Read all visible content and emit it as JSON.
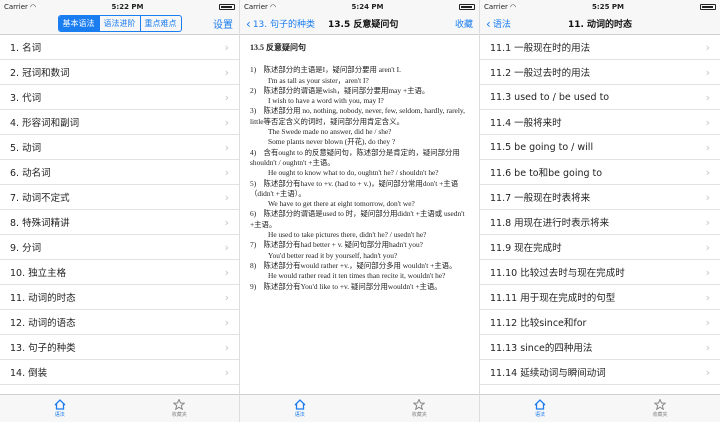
{
  "screen1": {
    "status": {
      "carrier": "Carrier",
      "time": "5:22 PM"
    },
    "segments": [
      "基本语法",
      "语法进阶",
      "重点难点"
    ],
    "settings_label": "设置",
    "items": [
      "1. 名词",
      "2. 冠词和数词",
      "3. 代词",
      "4. 形容词和副词",
      "5. 动词",
      "6. 动名词",
      "7. 动词不定式",
      "8. 特殊词精讲",
      "9. 分词",
      "10. 独立主格",
      "11. 动词的时态",
      "12. 动词的语态",
      "13. 句子的种类",
      "14. 倒装"
    ],
    "tabs": [
      "语法",
      "收藏夹"
    ]
  },
  "screen2": {
    "status": {
      "carrier": "Carrier",
      "time": "5:24 PM"
    },
    "back_label": "13. 句子的种类",
    "title": "13.5 反意疑问句",
    "favorite_label": "收藏",
    "heading": "13.5 反意疑问句",
    "lines": [
      {
        "t": "1)　陈述部分的主语是I，疑问部分要用 aren't I.",
        "ex": false
      },
      {
        "t": "I'm as tall as your sister，aren't I?",
        "ex": true
      },
      {
        "t": "2)　陈述部分的谓语是wish，疑问部分要用may +主语。",
        "ex": false
      },
      {
        "t": "I wish to have a word with you, may I?",
        "ex": true
      },
      {
        "t": "3)　陈述部分用 no, nothing, nobody, never, few, seldom, hardly, rarely, little等否定含义的词时，疑问部分用肯定含义。",
        "ex": false
      },
      {
        "t": "The Swede made no answer, did he / she?",
        "ex": true
      },
      {
        "t": "Some plants never blown (开花), do they ?",
        "ex": true
      },
      {
        "t": "4)　含有ought to 的反意疑问句，陈述部分是肯定的，疑问部分用shouldn't / oughtn't +主语。",
        "ex": false
      },
      {
        "t": "He ought to know what to do, oughtn't he? / shouldn't he?",
        "ex": true
      },
      {
        "t": "5)　陈述部分有have to +v. (had to + v.)，疑问部分常用don't +主语（didn't +主语）。",
        "ex": false
      },
      {
        "t": "We have to get there at eight tomorrow, don't we?",
        "ex": true
      },
      {
        "t": "6)　陈述部分的谓语是used to 时，疑问部分用didn't +主语或 usedn't +主语。",
        "ex": false
      },
      {
        "t": "He used to take pictures there, didn't he? / usedn't he?",
        "ex": true
      },
      {
        "t": "7)　陈述部分有had better + v. 疑问句部分用hadn't you?",
        "ex": false
      },
      {
        "t": "You'd better read it by yourself, hadn't you?",
        "ex": true
      },
      {
        "t": "8)　陈述部分有would rather +v.，疑问部分多用 wouldn't +主语。",
        "ex": false
      },
      {
        "t": "He would rather read it ten times than recite it, wouldn't he?",
        "ex": true
      },
      {
        "t": "9)　陈述部分有You'd like to +v. 疑问部分用wouldn't +主语。",
        "ex": false
      }
    ],
    "tabs": [
      "语法",
      "收藏夹"
    ]
  },
  "screen3": {
    "status": {
      "carrier": "Carrier",
      "time": "5:25 PM"
    },
    "back_label": "语法",
    "title": "11. 动词的时态",
    "items": [
      "11.1 一般现在时的用法",
      "11.2 一般过去时的用法",
      "11.3 used to / be used to",
      "11.4 一般将来时",
      "11.5 be going to / will",
      "11.6 be to和be going to",
      "11.7 一般现在时表将来",
      "11.8 用现在进行时表示将来",
      "11.9 现在完成时",
      "11.10 比较过去时与现在完成时",
      "11.11 用于现在完成时的句型",
      "11.12 比较since和for",
      "11.13 since的四种用法",
      "11.14 延续动词与瞬间动词"
    ],
    "tabs": [
      "语法",
      "收藏夹"
    ]
  },
  "colors": {
    "accent": "#1a7df0"
  }
}
